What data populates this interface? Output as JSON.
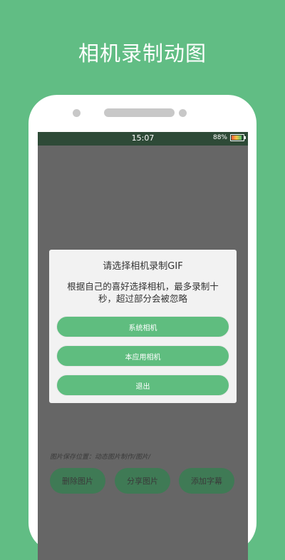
{
  "headline": "相机录制动图",
  "status_bar": {
    "time": "15:07",
    "battery_text": "88%",
    "battery_level": 0.88
  },
  "dialog": {
    "title": "请选择相机录制GIF",
    "message": "根据自己的喜好选择相机，最多录制十秒，超过部分会被忽略",
    "buttons": [
      "系统相机",
      "本应用相机",
      "退出"
    ]
  },
  "save_path": "图片保存位置：动态图片制作/图片/",
  "bottom_buttons": [
    "删除图片",
    "分享图片",
    "添加字幕"
  ],
  "colors": {
    "background": "#61bd84",
    "button_green": "#5fbd7f",
    "status_bar": "#2e4a37"
  }
}
